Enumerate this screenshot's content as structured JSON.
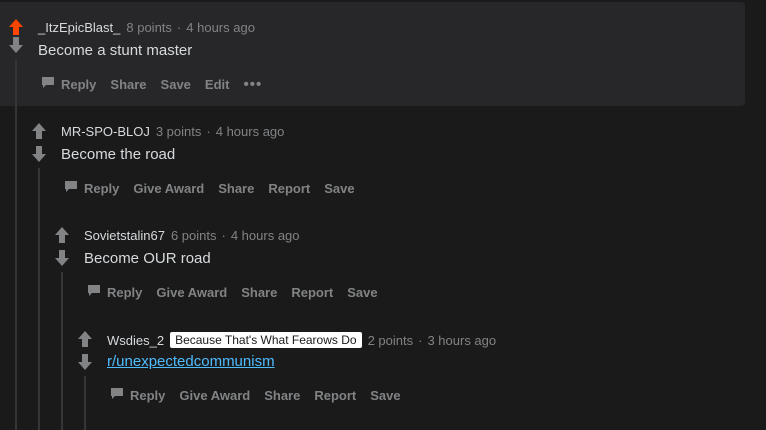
{
  "comments": [
    {
      "author": "_ItzEpicBlast_",
      "points": "8 points",
      "time": "4 hours ago",
      "text": "Become a stunt master",
      "actions": [
        "Reply",
        "Share",
        "Save",
        "Edit"
      ],
      "more": "•••",
      "upvoted": true
    },
    {
      "author": "MR-SPO-BLOJ",
      "points": "3 points",
      "time": "4 hours ago",
      "text": "Become the road",
      "actions": [
        "Reply",
        "Give Award",
        "Share",
        "Report",
        "Save"
      ]
    },
    {
      "author": "Sovietstalin67",
      "points": "6 points",
      "time": "4 hours ago",
      "text": "Become OUR road",
      "actions": [
        "Reply",
        "Give Award",
        "Share",
        "Report",
        "Save"
      ]
    },
    {
      "author": "Wsdies_2",
      "flair": "Because That's What Fearows Do",
      "points": "2 points",
      "time": "3 hours ago",
      "link": "r/unexpectedcommunism",
      "actions": [
        "Reply",
        "Give Award",
        "Share",
        "Report",
        "Save"
      ]
    }
  ],
  "separator": "·",
  "colors": {
    "upvote_active": "#ff4500",
    "arrow": "#818384",
    "link": "#4fbcff",
    "flair_bg": "#ffffff"
  }
}
